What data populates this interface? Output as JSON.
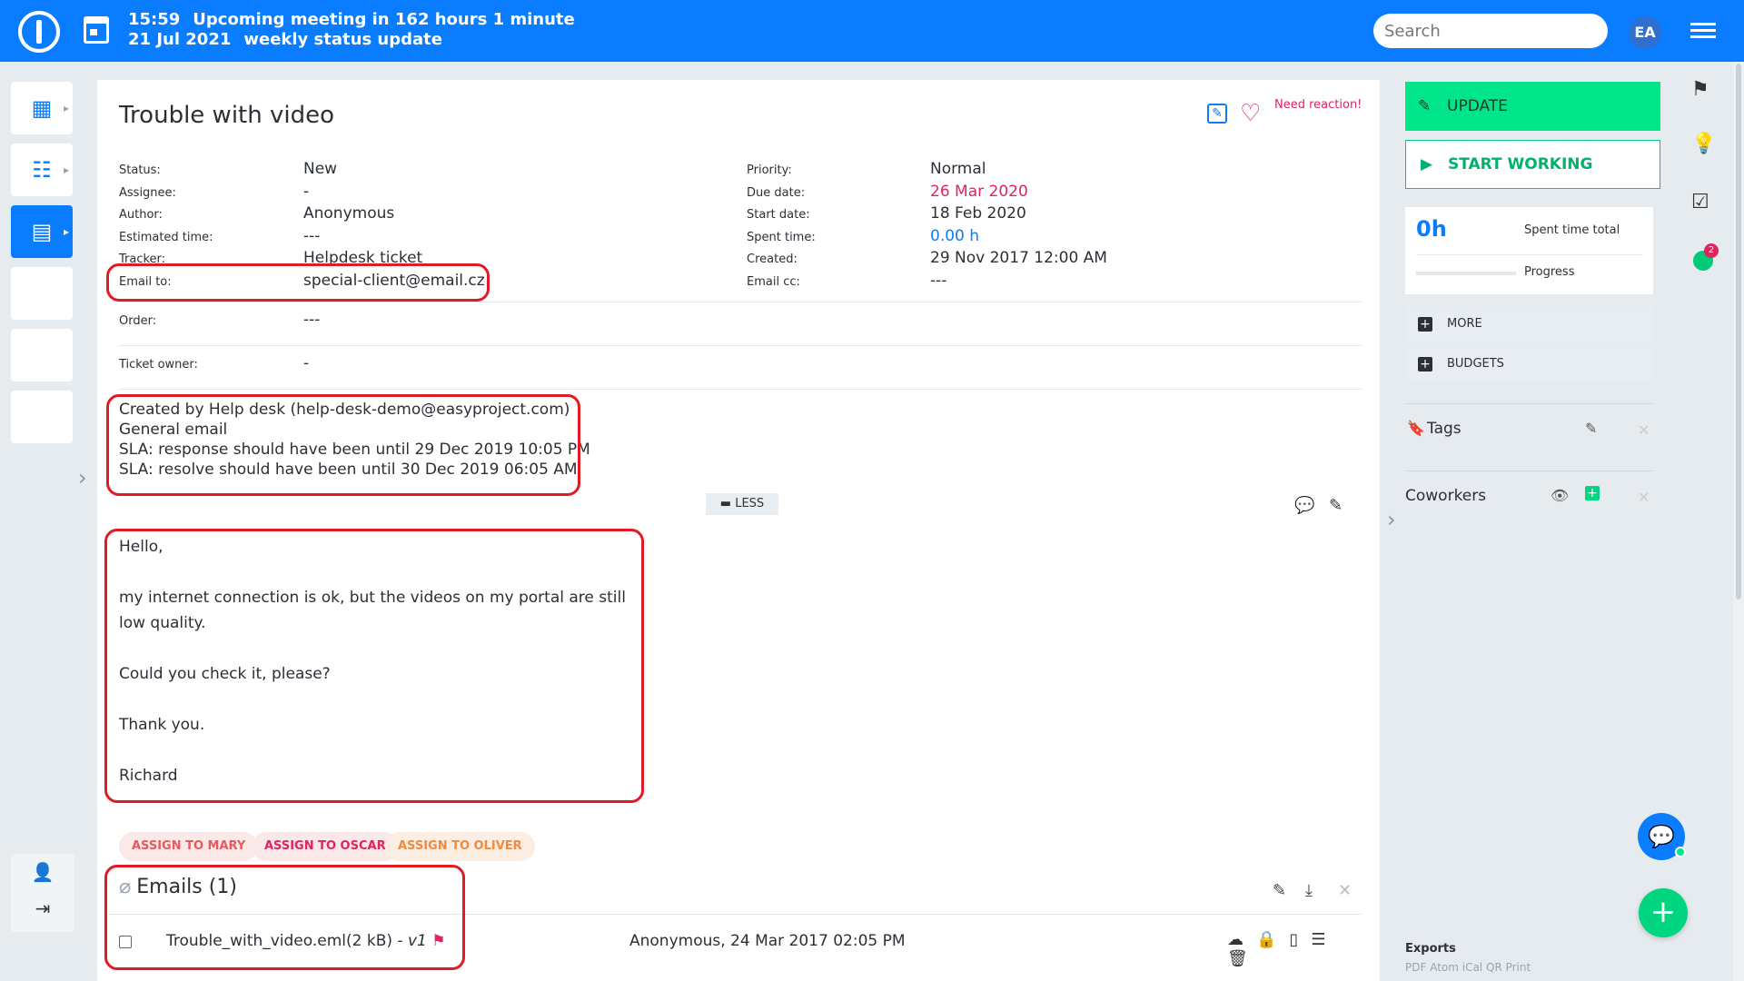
{
  "topbar": {
    "time": "15:59",
    "meeting": "Upcoming meeting in 162 hours 1 minute",
    "date": "21 Jul 2021",
    "meeting_name": "weekly status update",
    "search_placeholder": "Search",
    "avatar_initials": "EA"
  },
  "issue": {
    "title": "Trouble with video",
    "need_reaction": "Need reaction!",
    "left_attrs": [
      {
        "label": "Status:",
        "value": "New"
      },
      {
        "label": "Assignee:",
        "value": "-"
      },
      {
        "label": "Author:",
        "value": "Anonymous"
      },
      {
        "label": "Estimated time:",
        "value": "---"
      },
      {
        "label": "Tracker:",
        "value": "Helpdesk ticket"
      },
      {
        "label": "Email to:",
        "value": "special-client@email.cz"
      }
    ],
    "right_attrs": [
      {
        "label": "Priority:",
        "value": "Normal"
      },
      {
        "label": "Due date:",
        "value": "26 Mar 2020"
      },
      {
        "label": "Start date:",
        "value": "18 Feb 2020"
      },
      {
        "label": "Spent time:",
        "value": "0.00 h"
      },
      {
        "label": "Created:",
        "value": "29 Nov 2017 12:00 AM"
      },
      {
        "label": "Email cc:",
        "value": "---"
      }
    ],
    "order": {
      "label": "Order:",
      "value": "---"
    },
    "ticket_owner": {
      "label": "Ticket owner:",
      "value": "-"
    },
    "description": [
      "Created by Help desk (help-desk-demo@easyproject.com)",
      "General email",
      "SLA: response should have been until 29 Dec 2019 10:05 PM",
      "SLA: resolve should have been until 30 Dec 2019 06:05 AM"
    ],
    "less_label": "LESS",
    "body": [
      "Hello,",
      "my internet connection is ok, but the videos on my portal are still low quality.",
      "Could you check it, please?",
      "Thank you.",
      "Richard"
    ],
    "assign_buttons": [
      "ASSIGN TO MARY",
      "ASSIGN TO OSCAR",
      "ASSIGN TO OLIVER"
    ],
    "emails": {
      "title": "Emails (1)",
      "file_name": "Trouble_with_video.eml(2 kB)",
      "version": " - v1",
      "author_date": "Anonymous, 24 Mar 2017 02:05 PM"
    }
  },
  "sidebar": {
    "update_label": "UPDATE",
    "start_label": "START WORKING",
    "spent_value": "0h",
    "spent_label": "Spent time total",
    "progress_label": "Progress",
    "progress_value": 0,
    "more_label": "MORE",
    "budgets_label": "BUDGETS",
    "tags_label": "Tags",
    "coworkers_label": "Coworkers",
    "notification_count": "2",
    "exports_label": "Exports",
    "exports_list": "PDF  Atom  iCal  QR  Print"
  },
  "colors": {
    "primary": "#0a7cff",
    "success": "#00e58a",
    "danger": "#e0245e",
    "highlight": "#e01b24"
  }
}
